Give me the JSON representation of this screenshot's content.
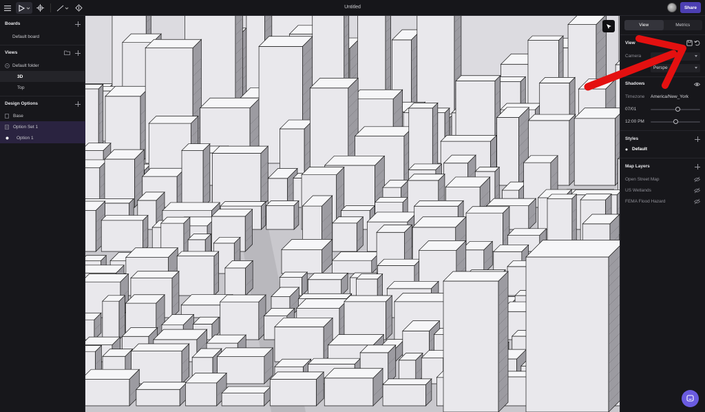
{
  "app": {
    "doc_title": "Untitled",
    "share_label": "Share"
  },
  "left_panel": {
    "boards_title": "Boards",
    "boards": [
      "Default board"
    ],
    "views_title": "Views",
    "folder_name": "Default folder",
    "views": [
      "3D",
      "Top"
    ],
    "design_options_title": "Design Options",
    "base_label": "Base",
    "option_set_label": "Option Set 1",
    "option_label": "Option 1"
  },
  "right_panel": {
    "tabs": [
      "View",
      "Metrics"
    ],
    "active_tab": "View",
    "view_title": "View",
    "camera_label": "Camera",
    "projection_value": "Perspe",
    "shadows_title": "Shadows",
    "timezone_label": "Timezone",
    "timezone_value": "America/New_York",
    "date_label": "07/01",
    "time_label": "12:00 PM",
    "date_slider_level": 0.55,
    "time_slider_level": 0.5,
    "styles_title": "Styles",
    "style_item": "Default",
    "map_layers_title": "Map Layers",
    "map_layers": [
      "Open Street Map",
      "US Wetlands",
      "FEMA Flood Hazard"
    ]
  },
  "colors": {
    "accent": "#4c3fb2",
    "chat_button": "#6a5be0",
    "annotation_arrow": "#e41010",
    "selected_row": "#2a2340"
  },
  "icons": [
    "menu-icon",
    "pointer-icon",
    "move-icon",
    "line-icon",
    "upload-icon",
    "save-view-icon",
    "reset-view-icon",
    "eye-icon",
    "eye-off-icon",
    "chat-icon"
  ]
}
